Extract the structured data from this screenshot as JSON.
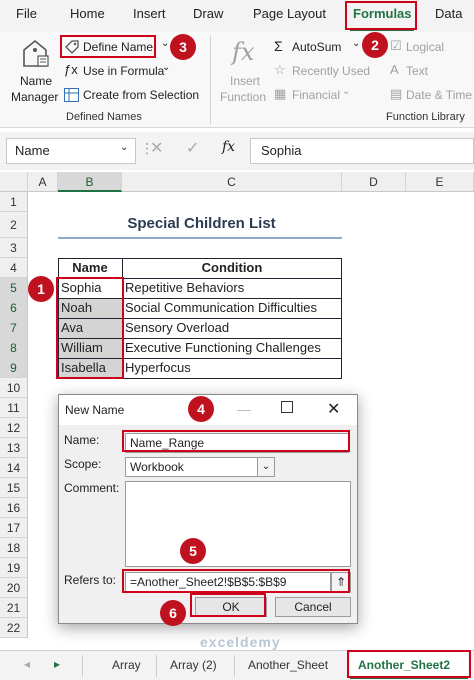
{
  "ribbon_tabs": [
    "File",
    "Home",
    "Insert",
    "Draw",
    "Page Layout",
    "Formulas",
    "Data"
  ],
  "defined_names": {
    "name_manager": [
      "Name",
      "Manager"
    ],
    "define_name": "Define Name",
    "use_in_formula": "Use in Formula",
    "create_from_selection": "Create from Selection",
    "group_label": "Defined Names"
  },
  "function_library": {
    "insert_function": [
      "Insert",
      "Function"
    ],
    "autosum": "AutoSum",
    "recently_used": "Recently Used",
    "financial": "Financial",
    "logical": "Logical",
    "text": "Text",
    "date_time": "Date & Time",
    "group_label": "Function Library"
  },
  "formula_bar": {
    "name_box": "Name",
    "fx": "fx",
    "value": "Sophia"
  },
  "columns": [
    "A",
    "B",
    "C",
    "D",
    "E"
  ],
  "rows": [
    "1",
    "2",
    "3",
    "4",
    "5",
    "6",
    "7",
    "8",
    "9",
    "10",
    "11",
    "12",
    "13",
    "14",
    "15",
    "16",
    "17",
    "18",
    "19",
    "20",
    "21",
    "22"
  ],
  "table": {
    "title": "Special Children List",
    "headers": [
      "Name",
      "Condition"
    ],
    "rows": [
      [
        "Sophia",
        "Repetitive Behaviors"
      ],
      [
        "Noah",
        "Social Communication Difficulties"
      ],
      [
        "Ava",
        "Sensory Overload"
      ],
      [
        "William",
        "Executive Functioning Challenges"
      ],
      [
        "Isabella",
        "Hyperfocus"
      ]
    ]
  },
  "dialog": {
    "title": "New Name",
    "name_label": "Name:",
    "name_value": "Name_Range",
    "scope_label": "Scope:",
    "scope_value": "Workbook",
    "comment_label": "Comment:",
    "refers_label": "Refers to:",
    "refers_value": "=Another_Sheet2!$B$5:$B$9",
    "ok": "OK",
    "cancel": "Cancel"
  },
  "badges": [
    "1",
    "2",
    "3",
    "4",
    "5",
    "6"
  ],
  "sheet_tabs": [
    "Array",
    "Array (2)",
    "Another_Sheet",
    "Another_Sheet2"
  ],
  "watermark": "exceldemy",
  "colors": {
    "accent_red": "#d0021b",
    "badge_red": "#c0111f",
    "excel_green": "#217346"
  }
}
